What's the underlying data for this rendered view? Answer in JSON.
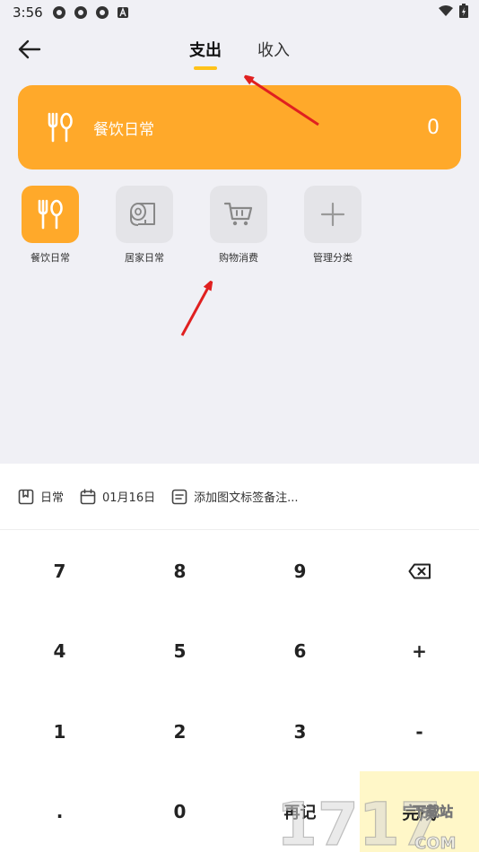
{
  "status_bar": {
    "time": "3:56"
  },
  "header": {
    "tabs": [
      {
        "label": "支出",
        "active": true
      },
      {
        "label": "收入",
        "active": false
      }
    ]
  },
  "amount_card": {
    "category": "餐饮日常",
    "amount": "0",
    "color": "#ffa92a"
  },
  "categories": [
    {
      "label": "餐饮日常",
      "icon": "fork-spoon-icon",
      "active": true
    },
    {
      "label": "居家日常",
      "icon": "toilet-roll-icon",
      "active": false
    },
    {
      "label": "购物消费",
      "icon": "shopping-cart-icon",
      "active": false
    },
    {
      "label": "管理分类",
      "icon": "plus-icon",
      "active": false
    }
  ],
  "meta": {
    "book": "日常",
    "date": "01月16日",
    "note_placeholder": "添加图文标签备注..."
  },
  "keypad": {
    "keys": [
      "7",
      "8",
      "9",
      "",
      "4",
      "5",
      "6",
      "+",
      "1",
      "2",
      "3",
      "-",
      ".",
      "0",
      "再记",
      "完成"
    ]
  },
  "watermark": {
    "text": "1717",
    "sub": "下载站",
    "domain": "COM"
  }
}
